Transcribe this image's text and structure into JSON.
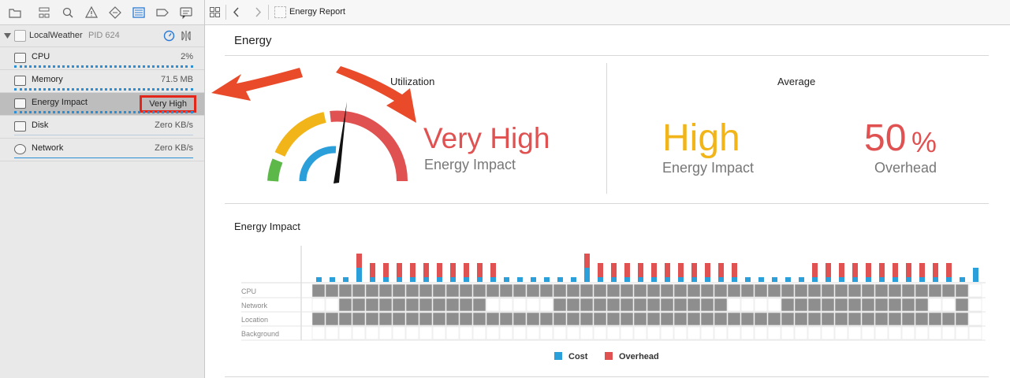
{
  "process": {
    "name": "LocalWeather",
    "pid": "PID 624"
  },
  "gauges": [
    {
      "label": "CPU",
      "value": "2%"
    },
    {
      "label": "Memory",
      "value": "71.5 MB"
    },
    {
      "label": "Energy Impact",
      "value": "Very High"
    },
    {
      "label": "Disk",
      "value": "Zero KB/s"
    },
    {
      "label": "Network",
      "value": "Zero KB/s"
    }
  ],
  "breadcrumb": {
    "title": "Energy Report"
  },
  "report": {
    "title": "Energy",
    "utilization": {
      "heading": "Utilization",
      "value": "Very High",
      "label": "Energy Impact",
      "level": "very-high"
    },
    "average": {
      "heading": "Average",
      "impact_value": "High",
      "impact_label": "Energy Impact",
      "overhead_value": "50",
      "overhead_unit": "%",
      "overhead_label": "Overhead"
    }
  },
  "colors": {
    "red": "#e05252",
    "orange": "#f2b519",
    "blue": "#2b9fd9",
    "green": "#5db84a",
    "gray": "#8e8e8e"
  },
  "chart_data": {
    "type": "bar",
    "title": "Energy Impact",
    "rows": [
      "CPU",
      "Network",
      "Location",
      "Background"
    ],
    "legend": [
      "Cost",
      "Overhead"
    ],
    "series": [
      {
        "name": "Cost",
        "values": [
          1,
          1,
          1,
          3,
          1,
          1,
          1,
          1,
          1,
          1,
          1,
          1,
          1,
          1,
          1,
          1,
          1,
          1,
          1,
          1,
          3,
          1,
          1,
          1,
          1,
          1,
          1,
          1,
          1,
          1,
          1,
          1,
          1,
          1,
          1,
          1,
          1,
          1,
          1,
          1,
          1,
          1,
          1,
          1,
          1,
          1,
          1,
          1,
          1,
          3
        ]
      },
      {
        "name": "Overhead",
        "values": [
          0,
          0,
          0,
          3,
          3,
          3,
          3,
          3,
          3,
          3,
          3,
          3,
          3,
          3,
          0,
          0,
          0,
          0,
          0,
          0,
          3,
          3,
          3,
          3,
          3,
          3,
          3,
          3,
          3,
          3,
          3,
          3,
          0,
          0,
          0,
          0,
          0,
          3,
          3,
          3,
          3,
          3,
          3,
          3,
          3,
          3,
          3,
          3,
          0,
          0
        ]
      }
    ],
    "activity": {
      "CPU": "1111111111111111111111111111111111111111111111111",
      "Network": "0011111111111000001111111111111000011111111111001",
      "Location": "1111111111111111111111111111111111111111111111111",
      "Background": "0000000000000000000000000000000000000000000000000"
    }
  }
}
